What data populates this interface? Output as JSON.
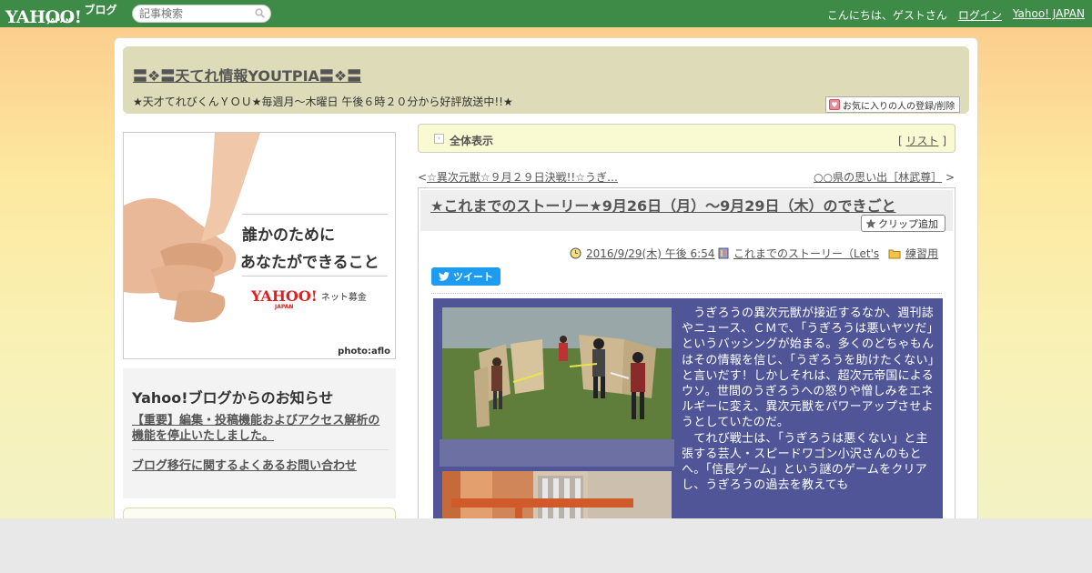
{
  "topbar": {
    "logo_main": "YAHOO!",
    "logo_sub": "JAPAN",
    "logo_blog": "ブログ",
    "search_placeholder": "記事検索",
    "greeting": "こんにちは、ゲストさん",
    "login_label": "ログイン",
    "yahoo_japan_label": "Yahoo! JAPAN"
  },
  "header": {
    "blog_title": "〓❖〓天てれ情報YOUTPIA〓❖〓",
    "blog_description": "★天才てれびくんＹＯＵ★毎週月～木曜日 午後６時２０分から好評放送中!!★",
    "fav_button_label": "お気に入りの人の登録/削除"
  },
  "ad": {
    "line1": "誰かのために",
    "line2": "あなたができること",
    "brand": "YAHOO!",
    "brand_sub": "JAPAN",
    "brand_tail": "ネット募金",
    "credit": "photo:aflo"
  },
  "notice": {
    "title": "Yahoo!ブログからのお知らせ",
    "link1": "【重要】編集・投稿機能およびアクセス解析の機能を停止いたしました。",
    "link2": "ブログ移行に関するよくあるお問い合わせ"
  },
  "article_nav": {
    "all_label": "全体表示",
    "list_open": "[",
    "list_label": "リスト",
    "list_close": "]",
    "prev_arrow": "<",
    "prev_label": "☆異次元獣☆９月２９日決戦!!☆うぎ…",
    "next_label": "○○県の思い出［林武尊］",
    "next_arrow": ">"
  },
  "article": {
    "title": "★これまでのストーリー★9月26日（月）～9月29日（木）のできごと",
    "clip_label": "クリップ追加",
    "date": "2016/9/29(木) 午後 6:54",
    "category": "これまでのストーリー（Let's",
    "folder": "練習用",
    "tweet_label": "ツイート",
    "paragraph1": "　うぎろうの異次元獣が接近するなか、週刊誌やニュース、ＣＭで、「うぎろうは悪いヤツだ」というバッシングが始まる。多くのどちゃもんはその情報を信じ、「うぎろうを助けたくない」と言いだす！しかしそれは、超次元帝国によるウソ。世間のうぎろうへの怒りや憎しみをエネルギーに変え、異次元獣をパワーアップさせようとしていたのだ。",
    "paragraph2": "　てれび戦士は、「うぎろうは悪くない」と主張する芸人・スピードワゴン小沢さんのもとへ。「信長ゲーム」という謎のゲームをクリアし、うぎろうの過去を教えても"
  },
  "colors": {
    "topbar": "#3e8b48",
    "header_bg": "#dddbb8",
    "content_bg": "#4f5596",
    "tweet": "#1d9bf0"
  }
}
